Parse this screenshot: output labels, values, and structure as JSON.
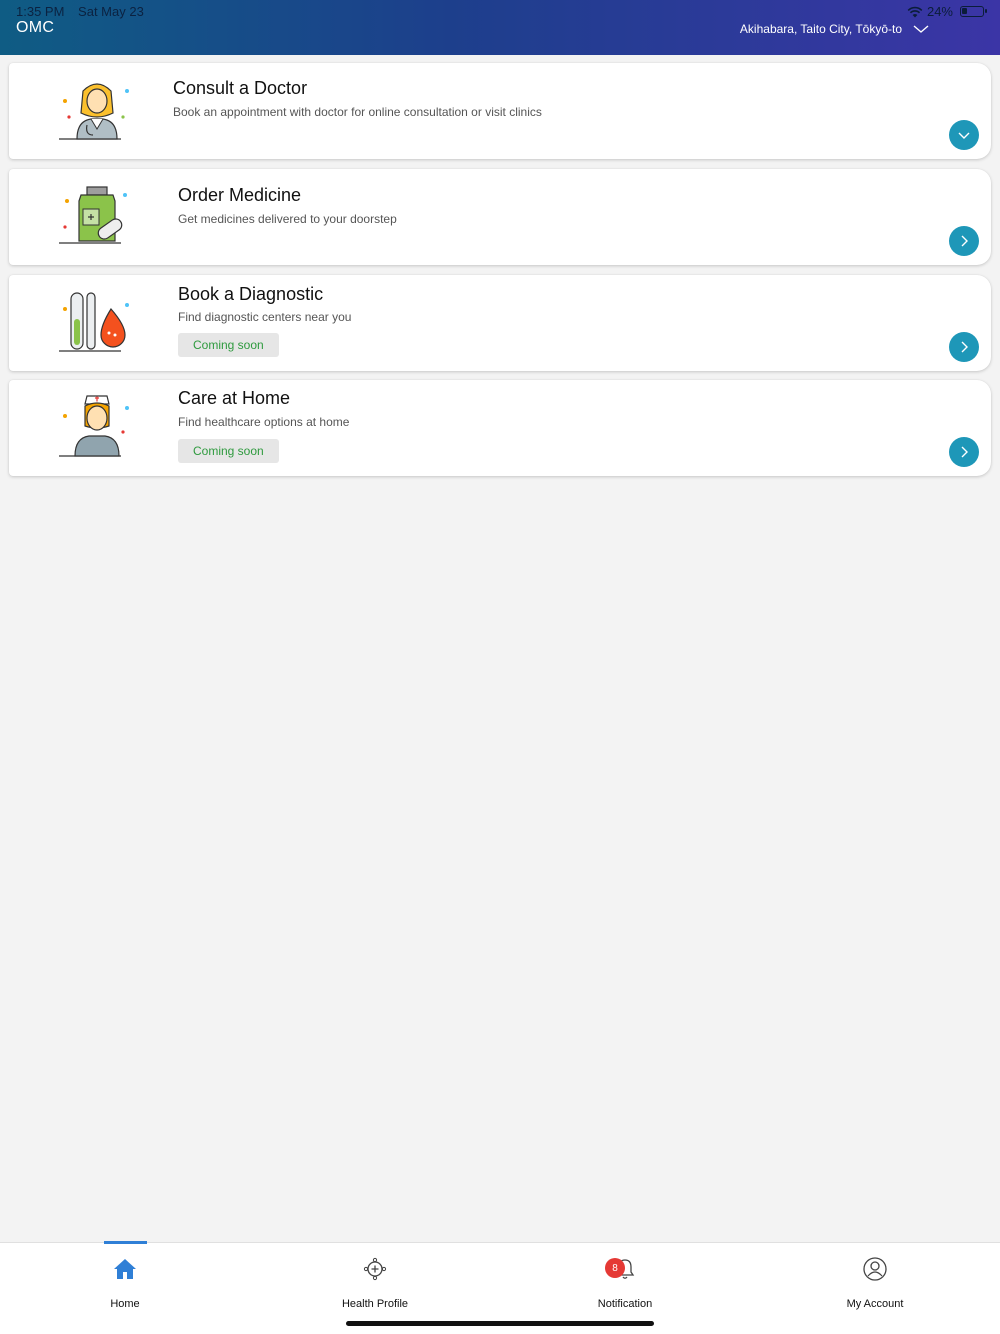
{
  "status_bar": {
    "time": "1:35 PM",
    "date": "Sat May 23",
    "battery": "24%"
  },
  "header": {
    "app_title": "OMC",
    "location": "Akihabara, Taito City, Tōkyō-to"
  },
  "cards": [
    {
      "title": "Consult a Doctor",
      "description": "Book an appointment with doctor for online consultation or visit clinics",
      "badge": "",
      "arrow_icon": "chevron-down-icon"
    },
    {
      "title": "Order Medicine",
      "description": "Get medicines delivered to your doorstep",
      "badge": "",
      "arrow_icon": "chevron-right-icon"
    },
    {
      "title": "Book a Diagnostic",
      "description": "Find diagnostic centers near you",
      "badge": "Coming soon",
      "arrow_icon": "chevron-right-icon"
    },
    {
      "title": "Care at Home",
      "description": "Find healthcare options at home",
      "badge": "Coming soon",
      "arrow_icon": "chevron-right-icon"
    }
  ],
  "bottom_nav": {
    "items": [
      {
        "label": "Home",
        "icon": "home-icon",
        "active": true
      },
      {
        "label": "Health Profile",
        "icon": "health-profile-icon",
        "active": false
      },
      {
        "label": "Notification",
        "icon": "bell-icon",
        "badge": "8",
        "active": false
      },
      {
        "label": "My Account",
        "icon": "account-icon",
        "active": false
      }
    ]
  },
  "colors": {
    "header_start": "#0f5c84",
    "header_end": "#3b35a6",
    "accent": "#1e97b8",
    "coming_soon_text": "#2e9a3e",
    "badge_red": "#e53935",
    "nav_active": "#2f7fd6"
  }
}
